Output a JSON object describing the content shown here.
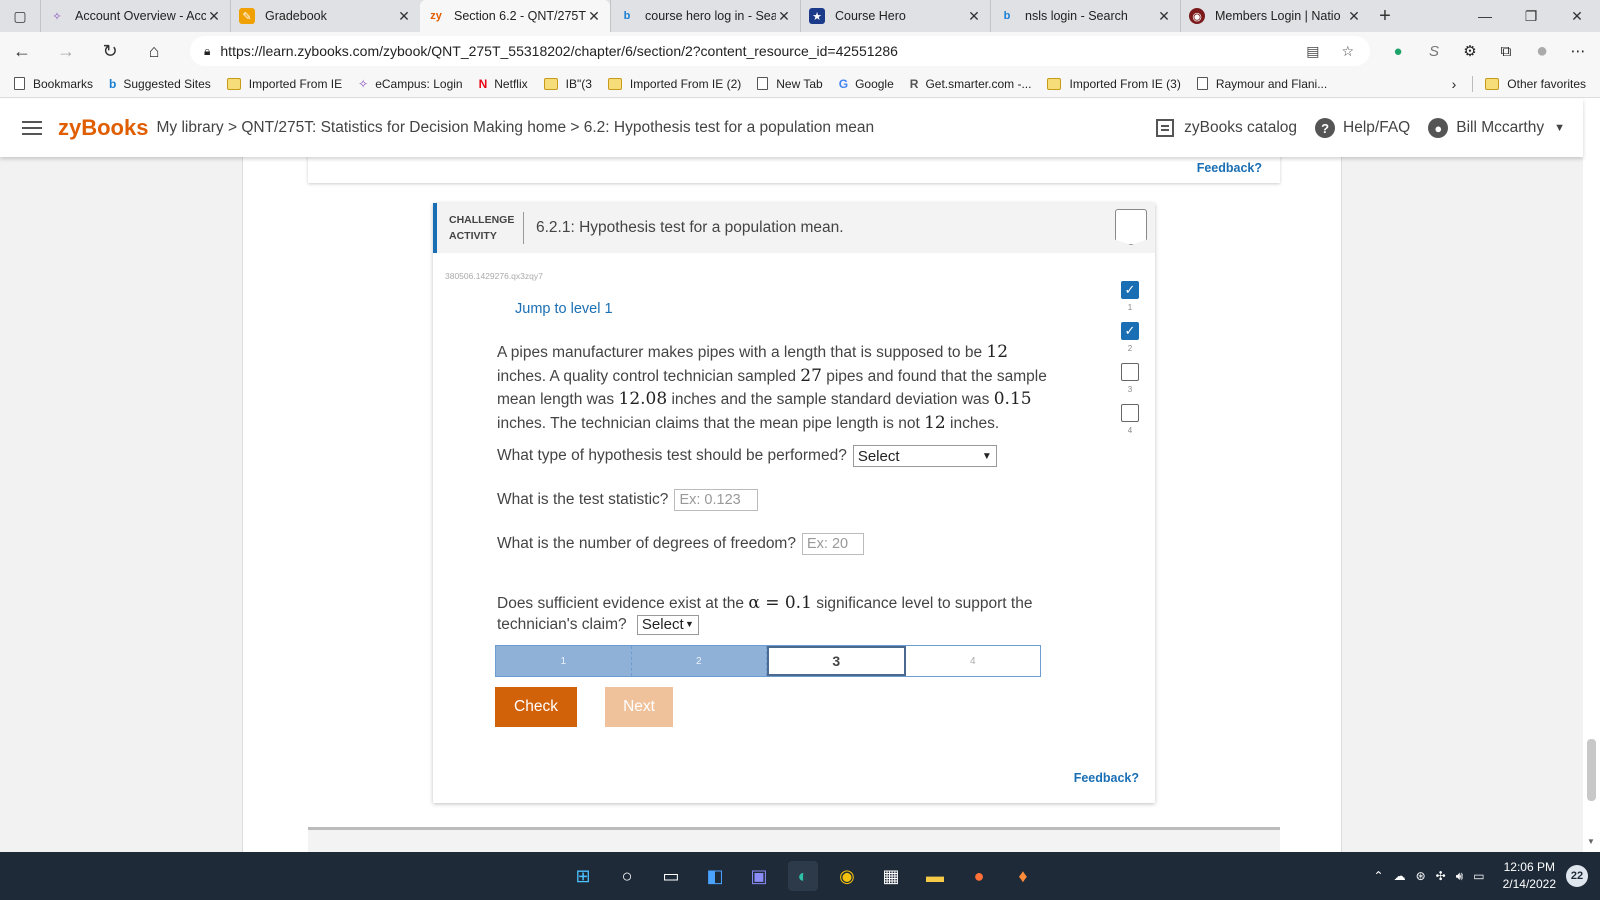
{
  "browser": {
    "tabs": [
      {
        "title": "Account Overview - Acc",
        "icon": "ie-icon",
        "color": "#8a4fbf"
      },
      {
        "title": "Gradebook",
        "icon": "gradebook-icon",
        "color": "#f0a000"
      },
      {
        "title": "Section 6.2 - QNT/275T",
        "icon": "zybooks-icon",
        "color": "#e05d00",
        "active": true
      },
      {
        "title": "course hero log in - Sea",
        "icon": "bing-icon",
        "color": "#1a7fd4"
      },
      {
        "title": "Course Hero",
        "icon": "coursehero-icon",
        "color": "#1b3a8a"
      },
      {
        "title": "nsls login - Search",
        "icon": "bing-icon",
        "color": "#1a7fd4"
      },
      {
        "title": "Members Login | Natio",
        "icon": "nsls-icon",
        "color": "#7a1a1a"
      }
    ],
    "url": "https://learn.zybooks.com/zybook/QNT_275T_55318202/chapter/6/section/2?content_resource_id=42551286",
    "bookmarks": [
      {
        "label": "Bookmarks",
        "type": "page"
      },
      {
        "label": "Suggested Sites",
        "type": "bing"
      },
      {
        "label": "Imported From IE",
        "type": "folder"
      },
      {
        "label": "eCampus: Login",
        "type": "ie"
      },
      {
        "label": "Netflix",
        "type": "netflix"
      },
      {
        "label": "IB\"(3",
        "type": "folder"
      },
      {
        "label": "Imported From IE (2)",
        "type": "folder"
      },
      {
        "label": "New Tab",
        "type": "page"
      },
      {
        "label": "Google",
        "type": "google"
      },
      {
        "label": "Get.smarter.com -...",
        "type": "r"
      },
      {
        "label": "Imported From IE (3)",
        "type": "folder"
      },
      {
        "label": "Raymour and Flani...",
        "type": "page"
      }
    ],
    "other_favorites": "Other favorites"
  },
  "header": {
    "logo": "zyBooks",
    "breadcrumb": "My library > QNT/275T: Statistics for Decision Making home > 6.2: Hypothesis test for a population mean",
    "catalog": "zyBooks catalog",
    "help": "Help/FAQ",
    "user": "Bill Mccarthy"
  },
  "prev_feedback": "Feedback?",
  "activity": {
    "label_line1": "CHALLENGE",
    "label_line2": "ACTIVITY",
    "title": "6.2.1: Hypothesis test for a population mean.",
    "id": "380506.1429276.qx3zqy7",
    "jump": "Jump to level 1",
    "problem": {
      "p1": "A pipes manufacturer makes pipes with a length that is supposed to be ",
      "v1": "12",
      "p2": " inches. A quality control technician sampled ",
      "v2": "27",
      "p3": " pipes and found that the sample mean length was ",
      "v3": "12.08",
      "p4": " inches and the sample standard deviation was ",
      "v4": "0.15",
      "p5": " inches. The technician claims that the mean pipe length is not ",
      "v5": "12",
      "p6": " inches."
    },
    "q1": {
      "text": "What type of hypothesis test should be performed?",
      "value": "Select"
    },
    "q2": {
      "text": "What is the test statistic?",
      "placeholder": "Ex: 0.123"
    },
    "q3": {
      "text": "What is the number of degrees of freedom?",
      "placeholder": "Ex: 20"
    },
    "q4": {
      "p1": "Does sufficient evidence exist at the ",
      "alpha": "α = 0.1",
      "p2": " significance level to support the technician's claim?",
      "value": "Select"
    },
    "levels": [
      "1",
      "2",
      "3",
      "4"
    ],
    "current_level": 3,
    "check": "Check",
    "next": "Next",
    "feedback": "Feedback?",
    "progress": [
      {
        "num": "1",
        "done": true
      },
      {
        "num": "2",
        "done": true
      },
      {
        "num": "3",
        "done": false
      },
      {
        "num": "4",
        "done": false
      }
    ]
  },
  "taskbar": {
    "time": "12:06 PM",
    "date": "2/14/2022",
    "notifications": "22"
  },
  "colors": {
    "accent": "#1a6fb4",
    "brand": "#e05d00",
    "check_button": "#d2620a",
    "next_button": "#f0c29c"
  }
}
